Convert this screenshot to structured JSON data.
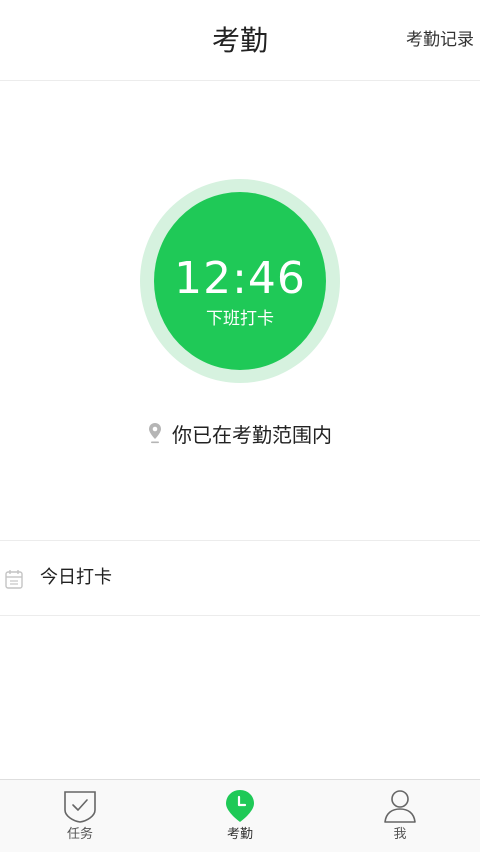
{
  "header": {
    "title": "考勤",
    "records_link": "考勤记录"
  },
  "punch": {
    "time": "12:46",
    "label": "下班打卡",
    "color": "#1fc957",
    "ring_color": "#d6f2df"
  },
  "location": {
    "icon": "location-pin-icon",
    "text": "你已在考勤范围内"
  },
  "today": {
    "icon": "calendar-icon",
    "label": "今日打卡"
  },
  "tabs": [
    {
      "label": "任务",
      "icon": "task-shield-check-icon",
      "active": false
    },
    {
      "label": "考勤",
      "icon": "clock-pin-icon",
      "active": true
    },
    {
      "label": "我",
      "icon": "user-icon",
      "active": false
    }
  ]
}
